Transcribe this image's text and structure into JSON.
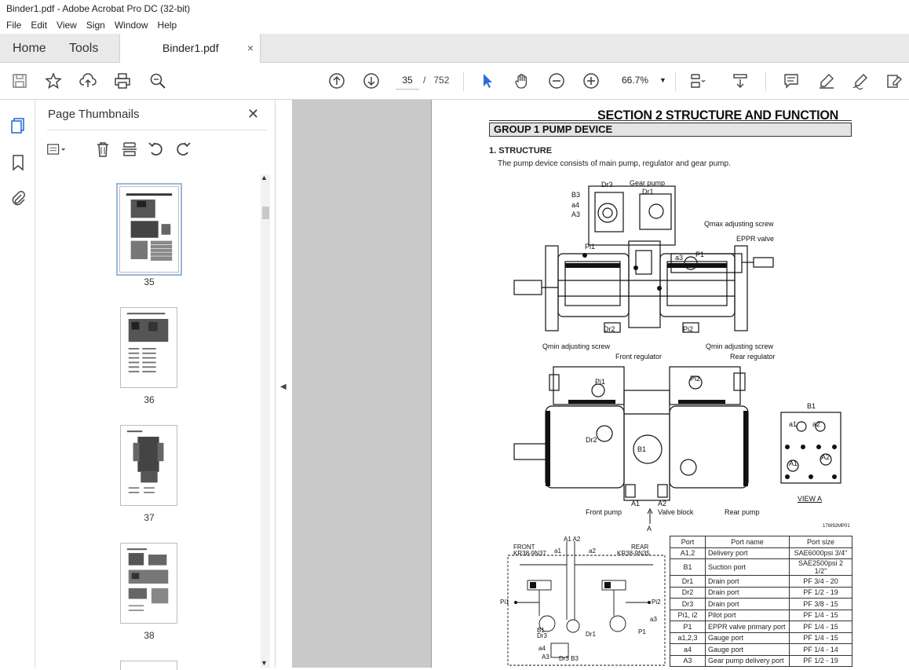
{
  "window": {
    "title": "Binder1.pdf - Adobe Acrobat Pro DC (32-bit)"
  },
  "menu": [
    "File",
    "Edit",
    "View",
    "Sign",
    "Window",
    "Help"
  ],
  "tabs": {
    "home": "Home",
    "tools": "Tools",
    "document": "Binder1.pdf",
    "close": "×"
  },
  "toolbar": {
    "current_page": "35",
    "page_sep": "/",
    "total_pages": "752",
    "zoom": "66.7%"
  },
  "sidebar": {
    "title": "Page Thumbnails",
    "thumbnails": [
      {
        "label": "35",
        "selected": true
      },
      {
        "label": "36",
        "selected": false
      },
      {
        "label": "37",
        "selected": false
      },
      {
        "label": "38",
        "selected": false
      }
    ]
  },
  "document": {
    "section_title": "SECTION 2  STRUCTURE AND FUNCTION",
    "group_title": "GROUP 1  PUMP DEVICE",
    "heading": "1. STRUCTURE",
    "description": "The pump device consists of main pump, regulator and gear pump.",
    "labels": {
      "dr3": "Dr3",
      "gear_pump": "Gear pump",
      "dr1": "Dr1",
      "b3": "B3",
      "a4": "a4",
      "a3": "A3",
      "qmax": "Qmax adjusting screw",
      "eppr": "EPPR valve",
      "pi1": "Pi1",
      "a3s": "a3",
      "p1": "P1",
      "dr2": "Dr2",
      "pi2": "Pi2",
      "qmin_front": "Qmin adjusting screw",
      "front_reg": "Front regulator",
      "qmin_rear": "Qmin adjusting screw",
      "rear_reg": "Rear regulator",
      "b1": "B1",
      "a1s": "a1",
      "a2s": "a2",
      "a1": "A1",
      "a2": "A2",
      "front_pump": "Front pump",
      "valve_block": "Valve block",
      "rear_pump": "Rear pump",
      "arrow_a": "A",
      "view_a": "VIEW  A",
      "fig_code": "17W92MP01",
      "front": "FRONT",
      "front_model": "KR38-9N37",
      "rear": "REAR",
      "rear_model": "KR38-9N35",
      "a1a2": "A1 A2",
      "sa1": "a1",
      "sa2": "a2",
      "spi1": "Pi1",
      "spi2": "Pi2",
      "sa3": "a3",
      "sb1": "B1",
      "sdr3": "Dr3",
      "sdr1": "Dr1",
      "sp1": "P1",
      "sa4": "a4",
      "sa3b": "A3",
      "sdr3b3": "Dr3 B3"
    },
    "port_table": {
      "headers": [
        "Port",
        "Port name",
        "Port size"
      ],
      "rows": [
        [
          "A1,2",
          "Delivery port",
          "SAE6000psi 3/4\""
        ],
        [
          "B1",
          "Suction port",
          "SAE2500psi 2 1/2\""
        ],
        [
          "Dr1",
          "Drain port",
          "PF 3/4 - 20"
        ],
        [
          "Dr2",
          "Drain port",
          "PF 1/2 - 19"
        ],
        [
          "Dr3",
          "Drain port",
          "PF 3/8 - 15"
        ],
        [
          "Pi1, i2",
          "Pilot port",
          "PF 1/4 - 15"
        ],
        [
          "P1",
          "EPPR valve primary port",
          "PF 1/4 - 15"
        ],
        [
          "a1,2,3",
          "Gauge port",
          "PF 1/4 - 15"
        ],
        [
          "a4",
          "Gauge port",
          "PF 1/4 - 14"
        ],
        [
          "A3",
          "Gear pump delivery port",
          "PF 1/2 - 19"
        ]
      ]
    }
  }
}
